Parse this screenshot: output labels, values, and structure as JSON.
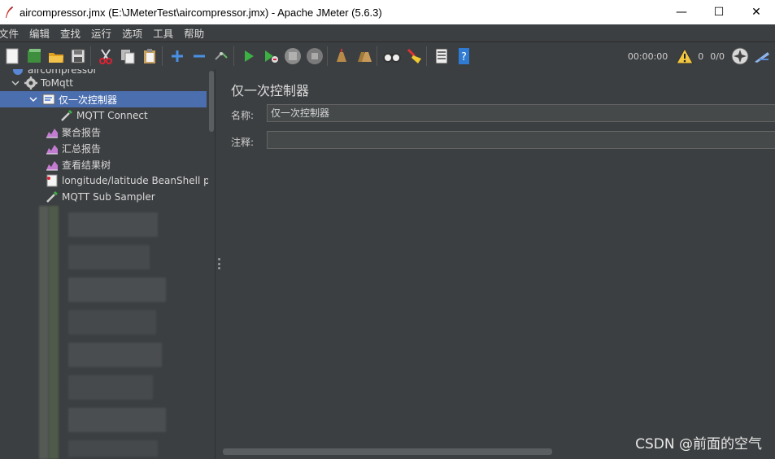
{
  "window": {
    "title": "aircompressor.jmx (E:\\JMeterTest\\aircompressor.jmx) - Apache JMeter (5.6.3)",
    "minimize": "—",
    "maximize": "☐",
    "close": "✕"
  },
  "menu": [
    "文件",
    "编辑",
    "查找",
    "运行",
    "选项",
    "工具",
    "帮助"
  ],
  "toolbar": {
    "timer": "00:00:00",
    "warnings": "0",
    "threads": "0/0"
  },
  "tree": {
    "root_partial": "aircompressor",
    "items": [
      {
        "label": "ToMqtt",
        "icon": "gear-icon"
      },
      {
        "label": "仅一次控制器",
        "icon": "controller-icon"
      },
      {
        "label": "MQTT Connect",
        "icon": "pipette-icon"
      },
      {
        "label": "聚合报告",
        "icon": "report-icon"
      },
      {
        "label": "汇总报告",
        "icon": "report-icon"
      },
      {
        "label": "查看结果树",
        "icon": "report-icon"
      },
      {
        "label": "longitude/latitude BeanShell prep",
        "icon": "script-icon"
      },
      {
        "label": "MQTT Sub Sampler",
        "icon": "pipette-icon"
      }
    ]
  },
  "content": {
    "heading": "仅一次控制器",
    "name_label": "名称:",
    "name_value": "仅一次控制器",
    "comment_label": "注释:",
    "comment_value": ""
  },
  "watermark": "CSDN @前面的空气",
  "colors": {
    "background": "#3c3f41",
    "selection": "#4b6eaf",
    "title_bar": "#ffffff"
  }
}
